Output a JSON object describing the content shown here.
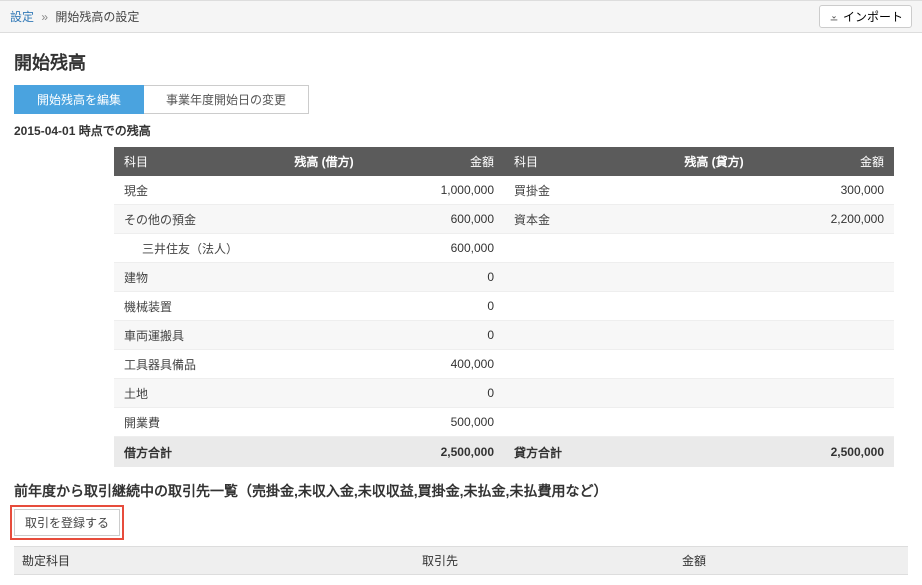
{
  "breadcrumb": {
    "root": "設定",
    "sep": "»",
    "current": "開始残高の設定"
  },
  "header": {
    "import_label": "インポート",
    "title": "開始残高"
  },
  "tabs": {
    "edit": "開始残高を編集",
    "change_start": "事業年度開始日の変更"
  },
  "date_line": "2015-04-01 時点での残高",
  "balances": {
    "debit": {
      "subject_header": "科目",
      "center_header": "残高 (借方)",
      "amount_header": "金額",
      "rows": [
        {
          "subject": "現金",
          "amount": "1,000,000",
          "indent": false
        },
        {
          "subject": "その他の預金",
          "amount": "600,000",
          "indent": false
        },
        {
          "subject": "三井住友（法人）",
          "amount": "600,000",
          "indent": true
        },
        {
          "subject": "建物",
          "amount": "0",
          "indent": false
        },
        {
          "subject": "機械装置",
          "amount": "0",
          "indent": false
        },
        {
          "subject": "車両運搬具",
          "amount": "0",
          "indent": false
        },
        {
          "subject": "工具器具備品",
          "amount": "400,000",
          "indent": false
        },
        {
          "subject": "土地",
          "amount": "0",
          "indent": false
        },
        {
          "subject": "開業費",
          "amount": "500,000",
          "indent": false
        }
      ],
      "total_label": "借方合計",
      "total_amount": "2,500,000"
    },
    "credit": {
      "subject_header": "科目",
      "center_header": "残高 (貸方)",
      "amount_header": "金額",
      "rows": [
        {
          "subject": "買掛金",
          "amount": "300,000"
        },
        {
          "subject": "資本金",
          "amount": "2,200,000"
        },
        {
          "subject": "",
          "amount": ""
        },
        {
          "subject": "",
          "amount": ""
        },
        {
          "subject": "",
          "amount": ""
        },
        {
          "subject": "",
          "amount": ""
        },
        {
          "subject": "",
          "amount": ""
        },
        {
          "subject": "",
          "amount": ""
        },
        {
          "subject": "",
          "amount": ""
        }
      ],
      "total_label": "貸方合計",
      "total_amount": "2,500,000"
    }
  },
  "transactions": {
    "heading": "前年度から取引継続中の取引先一覧（売掛金,未収入金,未収収益,買掛金,未払金,未払費用など）",
    "register_label": "取引を登録する",
    "columns": {
      "account": "勘定科目",
      "partner": "取引先",
      "amount": "金額"
    }
  }
}
